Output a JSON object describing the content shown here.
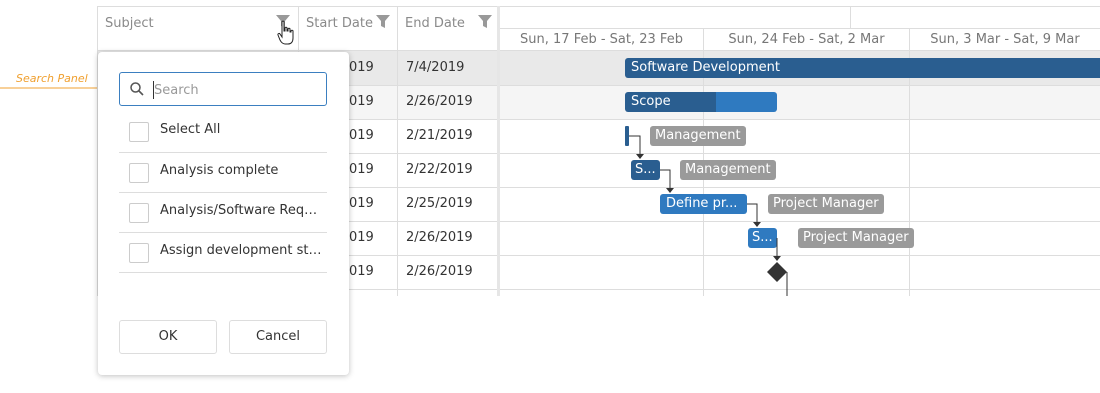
{
  "annotation": {
    "label": "Search Panel",
    "color": "#f0a030"
  },
  "columns": {
    "subject": "Subject",
    "start_date": "Start Date",
    "end_date": "End Date"
  },
  "timeline": {
    "weeks": [
      "Sun, 17 Feb - Sat, 23 Feb",
      "Sun, 24 Feb - Sat, 2 Mar",
      "Sun, 3 Mar - Sat, 9 Mar"
    ]
  },
  "rows": [
    {
      "start": "019",
      "end": "7/4/2019"
    },
    {
      "start": "019",
      "end": "2/26/2019"
    },
    {
      "start": "019",
      "end": "2/21/2019"
    },
    {
      "start": "019",
      "end": "2/22/2019"
    },
    {
      "start": "019",
      "end": "2/25/2019"
    },
    {
      "start": "019",
      "end": "2/26/2019"
    },
    {
      "start": "019",
      "end": "2/26/2019"
    }
  ],
  "tasks": {
    "t1": "Software Development",
    "t2": "Scope",
    "t4": "S...",
    "t5": "Define pr...",
    "t6": "S..."
  },
  "resources": {
    "r3": "Management",
    "r4": "Management",
    "r5": "Project Manager",
    "r6": "Project Manager"
  },
  "colors": {
    "task_dark": "#2a5e90",
    "task_blue": "#2f7ac0",
    "resource": "#9a9a9a",
    "search_border": "#3b7fc0"
  },
  "filter_popup": {
    "search_placeholder": "Search",
    "items": [
      "Select All",
      "Analysis complete",
      "Analysis/Software Requi...",
      "Assign development staff"
    ],
    "ok": "OK",
    "cancel": "Cancel"
  }
}
